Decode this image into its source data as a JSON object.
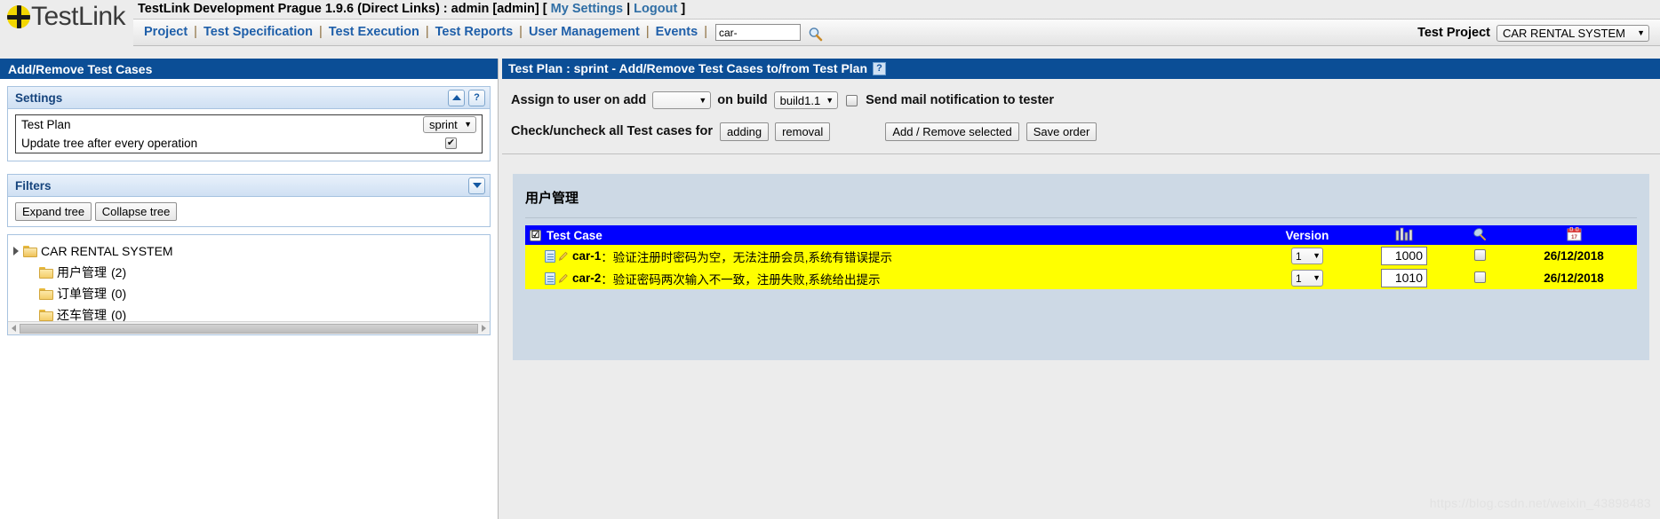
{
  "header": {
    "logo_text": "TestLink",
    "title": "TestLink Development Prague 1.9.6 (Direct Links) : admin [admin]",
    "bracket_open": "[",
    "bracket_close": "]",
    "my_settings": "My Settings",
    "logout": "Logout",
    "pipe": "|",
    "nav": [
      {
        "label": "Project"
      },
      {
        "label": "Test Specification"
      },
      {
        "label": "Test Execution"
      },
      {
        "label": "Test Reports"
      },
      {
        "label": "User Management"
      },
      {
        "label": "Events"
      }
    ],
    "search": {
      "value": "car-",
      "placeholder": "",
      "icon": "magnifier-icon"
    },
    "test_project": {
      "label": "Test Project",
      "selected": "CAR RENTAL SYSTEM",
      "arrow": "▼"
    }
  },
  "left_panel": {
    "title": "Add/Remove Test Cases",
    "settings": {
      "heading": "Settings",
      "collapse_icon": "collapse-up-icon",
      "help_label": "?",
      "test_plan_label": "Test Plan",
      "test_plan_value": "sprint",
      "update_tree_label": "Update tree after every operation",
      "update_tree_checked": "✔",
      "arrow": "▼"
    },
    "filters": {
      "heading": "Filters",
      "expand_icon": "expand-down-icon",
      "expand_tree": "Expand tree",
      "collapse_tree": "Collapse tree"
    },
    "tree": {
      "root": "CAR RENTAL SYSTEM",
      "nodes": [
        {
          "label": "用户管理",
          "count": "(2)"
        },
        {
          "label": "订单管理",
          "count": "(0)"
        },
        {
          "label": "还车管理",
          "count": "(0)"
        }
      ]
    }
  },
  "right_panel": {
    "title": "Test Plan : sprint - Add/Remove Test Cases to/from Test Plan",
    "help_label": "?",
    "assign_label": "Assign to user on add",
    "assign_value": "",
    "on_build_label": "on build",
    "build_value": "build1.1",
    "send_mail_label": "Send mail notification to tester",
    "send_mail_checked": false,
    "check_uncheck_label": "Check/uncheck all Test cases for",
    "btn_adding": "adding",
    "btn_removal": "removal",
    "btn_add_remove_selected": "Add / Remove selected",
    "btn_save_order": "Save order",
    "arrow": "▼",
    "group_title": "用户管理",
    "table": {
      "header_check": "☑",
      "columns": [
        {
          "key": "testcase",
          "label": "Test Case"
        },
        {
          "key": "version",
          "label": "Version"
        },
        {
          "key": "priority",
          "label": "",
          "icon": "bar-chart-icon"
        },
        {
          "key": "pin",
          "label": "",
          "icon": "pin-icon"
        },
        {
          "key": "date",
          "label": "",
          "icon": "calendar-icon"
        }
      ],
      "rows": [
        {
          "doc_icon": "document-icon",
          "edit_icon": "pencil-icon",
          "id": "car-1",
          "separator": "：",
          "name": "验证注册时密码为空，无法注册会员,系统有错误提示",
          "version": "1",
          "order": "1000",
          "pin_checked": false,
          "date": "26/12/2018"
        },
        {
          "doc_icon": "document-icon",
          "edit_icon": "pencil-icon",
          "id": "car-2",
          "separator": "：",
          "name": "验证密码两次输入不一致，注册失败,系统给出提示",
          "version": "1",
          "order": "1010",
          "pin_checked": false,
          "date": "26/12/2018"
        }
      ]
    }
  },
  "watermark": "https://blog.csdn.net/weixin_43898483",
  "colors": {
    "panel_header_blue": "#0b4e96",
    "table_header_blue": "#0000ff",
    "row_yellow": "#ffff00",
    "content_bg": "#cdd9e5",
    "link_blue": "#1f5fa9",
    "logo_yellow": "#f2d600"
  }
}
